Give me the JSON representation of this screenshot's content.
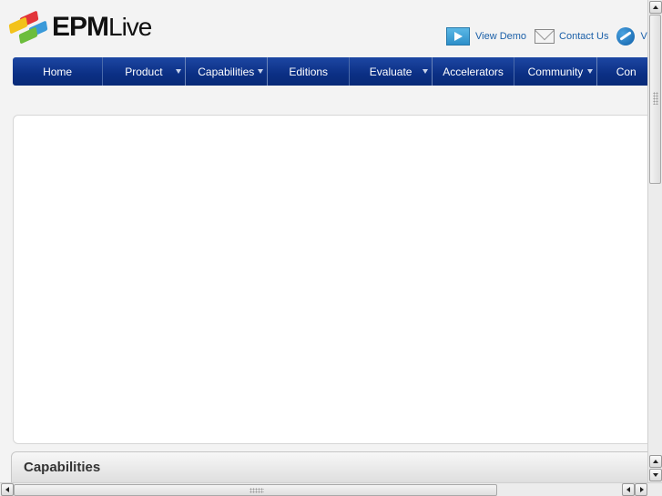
{
  "brand": {
    "logo_bold": "EPM",
    "logo_light": "Live"
  },
  "toplinks": [
    {
      "label": "View Demo",
      "icon": "play-video-icon"
    },
    {
      "label": "Contact Us",
      "icon": "envelope-icon"
    },
    {
      "label": "View",
      "icon": "globe-icon"
    }
  ],
  "nav": {
    "items": [
      {
        "label": "Home",
        "has_dropdown": false
      },
      {
        "label": "Product",
        "has_dropdown": true
      },
      {
        "label": "Capabilities",
        "has_dropdown": true
      },
      {
        "label": "Editions",
        "has_dropdown": false
      },
      {
        "label": "Evaluate",
        "has_dropdown": true
      },
      {
        "label": "Accelerators",
        "has_dropdown": false
      },
      {
        "label": "Community",
        "has_dropdown": true
      },
      {
        "label": "Con",
        "has_dropdown": false
      }
    ]
  },
  "sections": {
    "capabilities_title": "Capabilities"
  },
  "colors": {
    "nav_blue": "#0b2f84",
    "link_blue": "#1a5fa8"
  }
}
